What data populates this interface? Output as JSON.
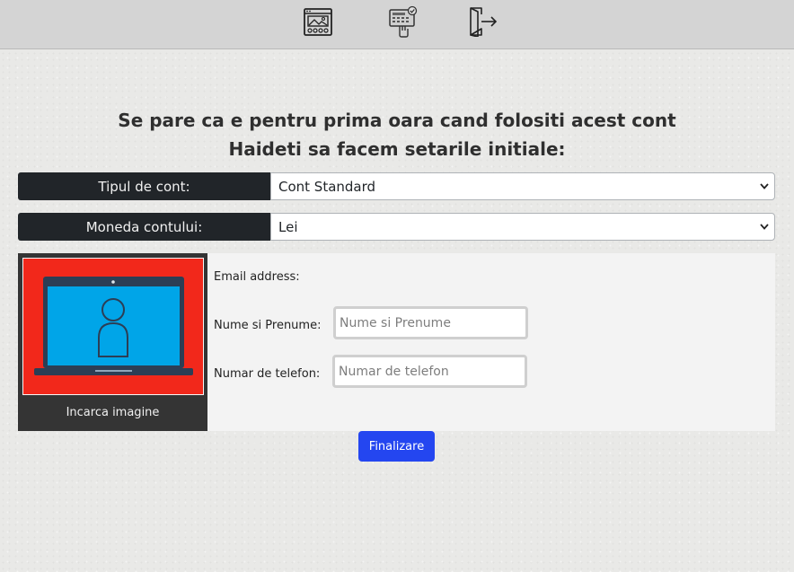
{
  "topbar": {
    "icons": [
      {
        "name": "gallery-window-icon"
      },
      {
        "name": "payment-terminal-icon"
      },
      {
        "name": "logout-icon"
      }
    ]
  },
  "heading": {
    "line1": "Se pare ca e pentru prima oara cand folositi acest cont",
    "line2": "Haideti sa facem setarile initiale:"
  },
  "account_type": {
    "label": "Tipul de cont:",
    "value": "Cont Standard"
  },
  "currency": {
    "label": "Moneda contului:",
    "value": "Lei"
  },
  "profile": {
    "upload_label": "Incarca imagine",
    "avatar_icon": "laptop-user-icon",
    "email_label": "Email address:",
    "name_label": "Nume si Prenume:",
    "name_placeholder": "Nume si Prenume",
    "phone_label": "Numar de telefon:",
    "phone_placeholder": "Numar de telefon"
  },
  "actions": {
    "finish_label": "Finalizare"
  },
  "colors": {
    "primary_button": "#2446f0",
    "label_dark": "#212529",
    "avatar_bg": "#f2281b",
    "screen_blue": "#00a5e8"
  }
}
